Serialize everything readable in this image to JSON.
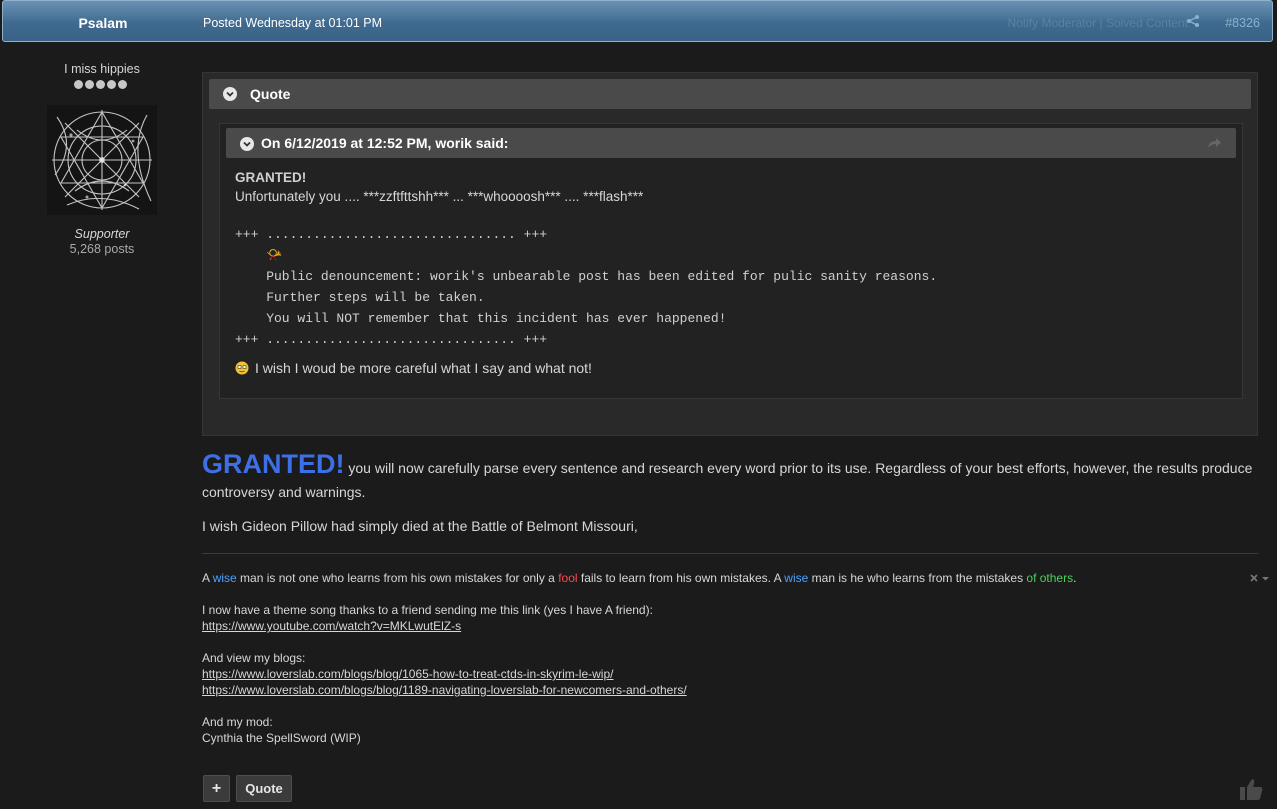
{
  "post": {
    "author": "Psalam",
    "posted": "Posted Wednesday at 01:01 PM",
    "breadcrumb": "Notify Moderator | Solved Content",
    "number": "#8326"
  },
  "author_panel": {
    "title": "I miss hippies",
    "pips": 5,
    "group": "Supporter",
    "posts": "5,268 posts"
  },
  "quote": {
    "header": "Quote",
    "citation": "On 6/12/2019 at 12:52 PM, worik said:",
    "granted": "GRANTED!",
    "line1": "Unfortunately  you .... ***zzftfttshh*** ...   ***whoooosh*** .... ***flash***",
    "mono": "+++ ................................ +++\n    📯\n    Public denouncement: worik's unbearable post has been edited for pulic sanity reasons.\n    Further steps will be taken.\n    You will NOT remember that this incident has ever happened!\n+++ ................................ +++",
    "wish": "I wish I woud be more careful what I say and what not!"
  },
  "reply": {
    "granted": "GRANTED!",
    "text": " you will now carefully parse every sentence and research every word prior to its use. Regardless of your best efforts, however, the results produce controversy and warnings.",
    "wish": "I wish Gideon Pillow had simply died at the Battle of Belmont Missouri,"
  },
  "signature": {
    "s1": "A ",
    "w1": "wise",
    "s2": " man is not one who learns from his own mistakes for only a ",
    "fool": "fool",
    "s3": " fails to learn from his own mistakes. A ",
    "w2": "wise",
    "s4": " man is he who learns from the mistakes ",
    "others": "of others",
    "s5": ".",
    "theme": "I now have a theme song thanks to a friend sending me this link (yes I have A friend):",
    "youtube": "https://www.youtube.com/watch?v=MKLwutElZ-s",
    "blogs_label": "And view my blogs:",
    "blog1": "https://www.loverslab.com/blogs/blog/1065-how-to-treat-ctds-in-skyrim-le-wip/",
    "blog2": "https://www.loverslab.com/blogs/blog/1189-navigating-loverslab-for-newcomers-and-others/",
    "mod_label": "And my mod:",
    "mod": "Cynthia the SpellSword (WIP)"
  },
  "actions": {
    "plus": "+",
    "quote": "Quote"
  }
}
